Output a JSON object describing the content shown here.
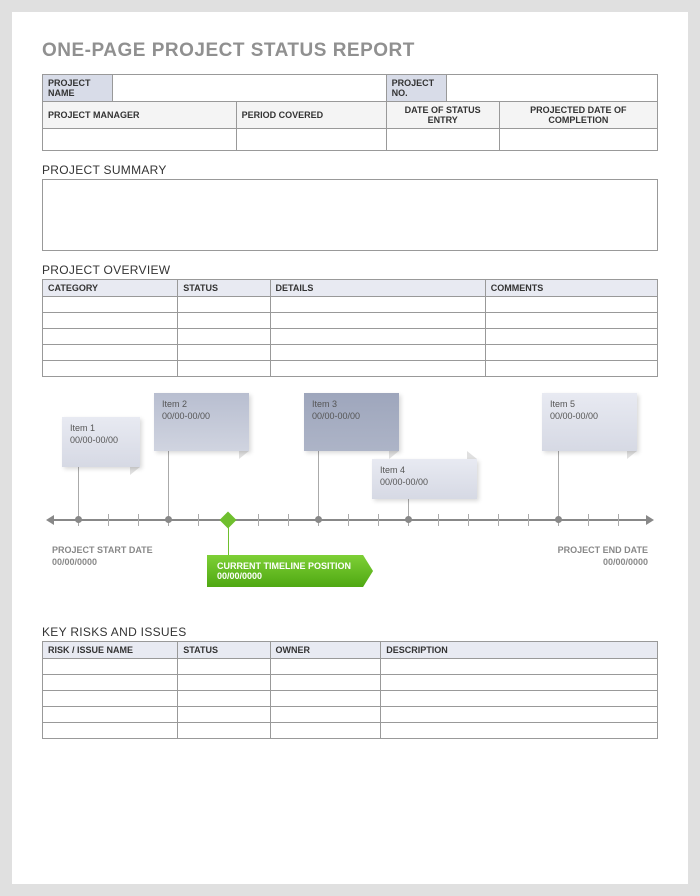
{
  "title": "ONE-PAGE PROJECT STATUS REPORT",
  "header": {
    "project_name_label": "PROJECT NAME",
    "project_name": "",
    "project_no_label": "PROJECT NO.",
    "project_no": "",
    "project_manager_label": "PROJECT MANAGER",
    "period_covered_label": "PERIOD COVERED",
    "date_status_entry_label": "DATE OF STATUS ENTRY",
    "projected_completion_label": "PROJECTED DATE OF COMPLETION",
    "project_manager": "",
    "period_covered": "",
    "date_status_entry": "",
    "projected_completion": ""
  },
  "summary": {
    "label": "PROJECT SUMMARY",
    "text": ""
  },
  "overview": {
    "label": "PROJECT OVERVIEW",
    "cols": {
      "category": "CATEGORY",
      "status": "STATUS",
      "details": "DETAILS",
      "comments": "COMMENTS"
    },
    "rows": [
      {
        "category": "",
        "status": "",
        "details": "",
        "comments": ""
      },
      {
        "category": "",
        "status": "",
        "details": "",
        "comments": ""
      },
      {
        "category": "",
        "status": "",
        "details": "",
        "comments": ""
      },
      {
        "category": "",
        "status": "",
        "details": "",
        "comments": ""
      },
      {
        "category": "",
        "status": "",
        "details": "",
        "comments": ""
      }
    ]
  },
  "timeline": {
    "start_label": "PROJECT START DATE",
    "start_date": "00/00/0000",
    "end_label": "PROJECT END DATE",
    "end_date": "00/00/0000",
    "current_label": "CURRENT TIMELINE POSITION",
    "current_date": "00/00/0000",
    "items": [
      {
        "name": "Item 1",
        "range": "00/00-00/00"
      },
      {
        "name": "Item 2",
        "range": "00/00-00/00"
      },
      {
        "name": "Item 3",
        "range": "00/00-00/00"
      },
      {
        "name": "Item 4",
        "range": "00/00-00/00"
      },
      {
        "name": "Item 5",
        "range": "00/00-00/00"
      }
    ]
  },
  "risks": {
    "label": "KEY RISKS AND ISSUES",
    "cols": {
      "name": "RISK / ISSUE NAME",
      "status": "STATUS",
      "owner": "OWNER",
      "description": "DESCRIPTION"
    },
    "rows": [
      {
        "name": "",
        "status": "",
        "owner": "",
        "description": ""
      },
      {
        "name": "",
        "status": "",
        "owner": "",
        "description": ""
      },
      {
        "name": "",
        "status": "",
        "owner": "",
        "description": ""
      },
      {
        "name": "",
        "status": "",
        "owner": "",
        "description": ""
      },
      {
        "name": "",
        "status": "",
        "owner": "",
        "description": ""
      }
    ]
  }
}
